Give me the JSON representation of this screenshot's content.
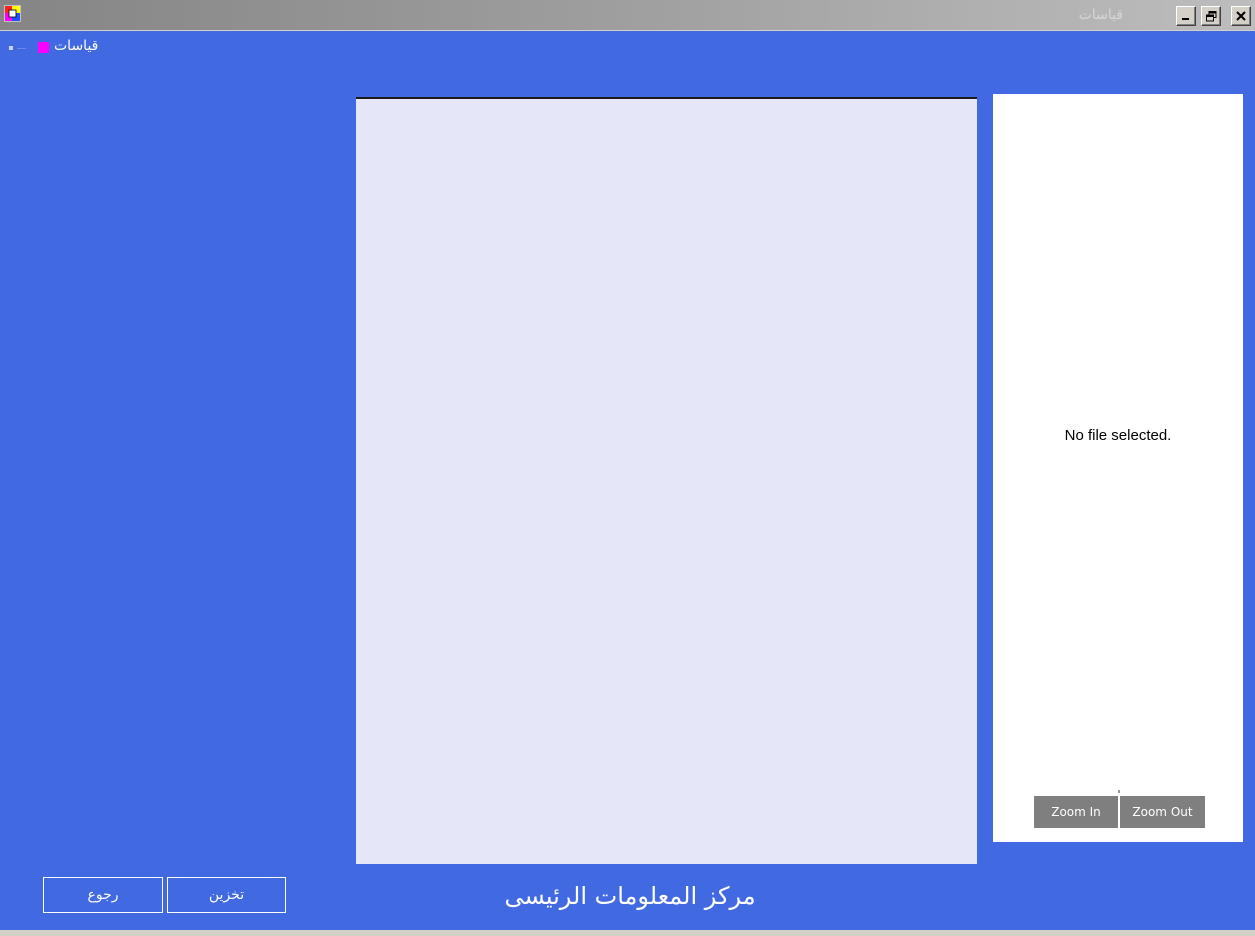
{
  "window": {
    "title": "قياسات",
    "controls": {
      "minimize_icon": "minimize-icon",
      "restore_icon": "restore-icon",
      "close_icon": "close-icon"
    },
    "app_icon": "app-icon"
  },
  "menu": {
    "items": [
      {
        "label": "قياسات",
        "swatch_color": "#ff00ff"
      }
    ]
  },
  "viewer": {
    "status": "No file selected.",
    "zoom_in_label": "Zoom In",
    "zoom_out_label": "Zoom Out"
  },
  "footer": {
    "title": "مركز المعلومات الرئيسى",
    "back_label": "رجوع",
    "save_label": "تخزين"
  },
  "colors": {
    "background": "#4169e1",
    "center_panel": "#e5e7f8",
    "viewer_panel": "#ffffff",
    "zoom_button": "#7f7f7f"
  }
}
